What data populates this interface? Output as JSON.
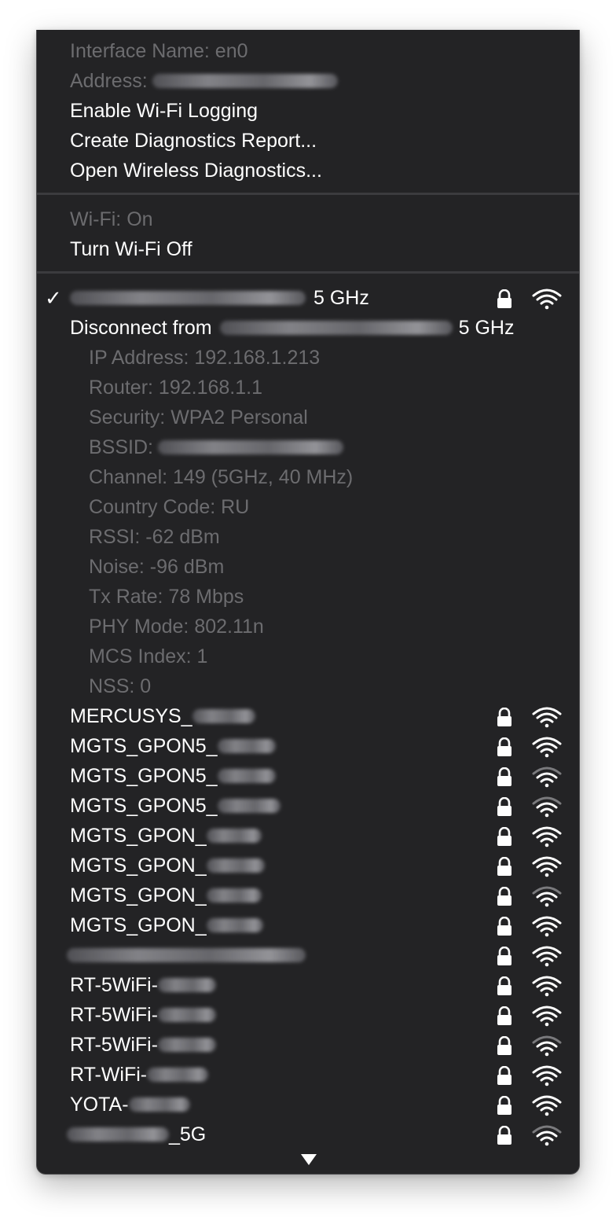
{
  "interface_info": {
    "interface_name": "Interface Name: en0",
    "address_label": "Address:",
    "enable_logging": "Enable Wi-Fi Logging",
    "create_report": "Create Diagnostics Report...",
    "open_diagnostics": "Open Wireless Diagnostics..."
  },
  "wifi_power": {
    "status": "Wi-Fi: On",
    "toggle": "Turn Wi-Fi Off"
  },
  "current_network": {
    "checkmark": "✓",
    "band": "5 GHz",
    "disconnect_label": "Disconnect from",
    "disconnect_band": "5 GHz",
    "details": [
      "IP Address: 192.168.1.213",
      "Router: 192.168.1.1",
      "Security: WPA2 Personal",
      "BSSID:",
      "Channel: 149 (5GHz, 40 MHz)",
      "Country Code: RU",
      "RSSI: -62 dBm",
      "Noise: -96 dBm",
      "Tx Rate: 78 Mbps",
      "PHY Mode: 802.11n",
      "MCS Index: 1",
      "NSS: 0"
    ],
    "signal_bars": 3,
    "icons": [
      "lock-icon",
      "wifi-icon"
    ]
  },
  "networks": [
    {
      "name": "MERCUSYS_",
      "signal_bars": 3
    },
    {
      "name": "MGTS_GPON5_",
      "signal_bars": 3
    },
    {
      "name": "MGTS_GPON5_",
      "signal_bars": 2
    },
    {
      "name": "MGTS_GPON5_",
      "signal_bars": 2
    },
    {
      "name": "MGTS_GPON_",
      "signal_bars": 3
    },
    {
      "name": "MGTS_GPON_",
      "signal_bars": 3
    },
    {
      "name": "MGTS_GPON_",
      "signal_bars": 2
    },
    {
      "name": "MGTS_GPON_",
      "signal_bars": 3
    },
    {
      "name": "",
      "signal_bars": 3
    },
    {
      "name": "RT-5WiFi-",
      "signal_bars": 3
    },
    {
      "name": "RT-5WiFi-",
      "signal_bars": 3
    },
    {
      "name": "RT-5WiFi-",
      "signal_bars": 2
    },
    {
      "name": "RT-WiFi-",
      "signal_bars": 3
    },
    {
      "name": "YOTA-",
      "signal_bars": 3
    },
    {
      "name": "_5G",
      "signal_bars": 2
    }
  ],
  "colors": {
    "menu_background": "#232325",
    "text_enabled": "#ffffff",
    "text_disabled": "#6c6c6f",
    "separator": "#3b3b3e"
  }
}
